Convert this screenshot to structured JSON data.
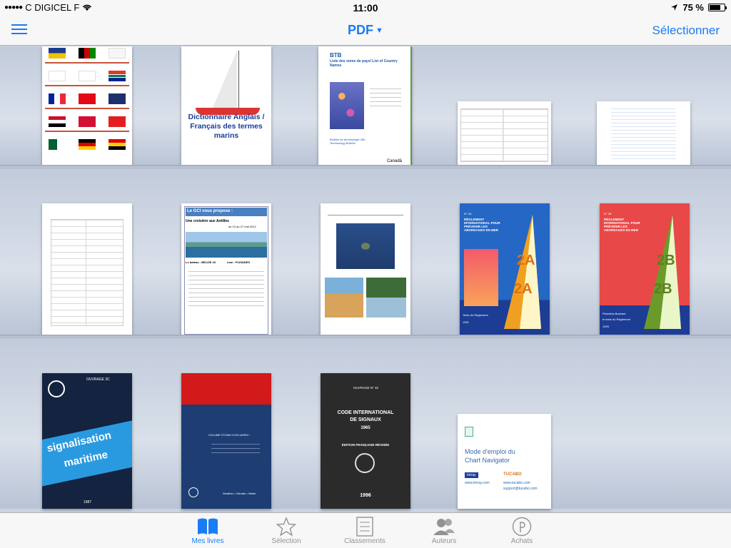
{
  "status": {
    "carrier": "C DIGICEL F",
    "time": "11:00",
    "battery": "75 %",
    "battery_fraction": 0.75
  },
  "nav": {
    "title": "PDF",
    "select_label": "Sélectionner"
  },
  "books": {
    "b2_title": "Dictionnaire Anglais / Français des termes marins",
    "b3_head": "Liste des noms de pays/ List of Country Names",
    "b3_brand": "BTB",
    "b3_sub": "Bulletin de terminologie 256 Terminology Bulletin",
    "b3_footer": "Canadä",
    "b7_head": "Le GCI vous propose :",
    "b7_sub": "Une croisière aux Antilles",
    "b7_dates": "du 13 au 27 mai 2012",
    "b7_boat1": "Le bateau : BELIZE 43",
    "b7_boat2": "nom : PLEIADES",
    "b9_head": "RÈGLEMENT INTERNATIONAL POUR PRÉVENIR LES ABORDAGES EN MER",
    "b9_foot": "Texte du Règlement",
    "b9_year": "1991",
    "b9_no": "N° 2A",
    "b10_head": "RÈGLEMENT INTERNATIONAL POUR PRÉVENIR LES ABORDAGES EN MER",
    "b10_foot1": "Planches illustrant",
    "b10_foot2": "le texte du Règlement",
    "b10_year": "1993",
    "b10_no": "N° 2B",
    "b11_ouvrage": "OUVRAGE 3C",
    "b11_word1": "signalisation",
    "b11_word2": "maritime",
    "b11_year": "1987",
    "b12_title": "VOLUME I/TOMO I/VOLUMEN I",
    "b12_foot": "Weather • Climate • Water",
    "b13_ouvrage": "OUVRAGE N° 32",
    "b13_title1": "CODE INTERNATIONAL",
    "b13_title2": "DE SIGNAUX",
    "b13_year1": "1965",
    "b13_edition": "ÉDITION FRANÇAISE RÉVISÉE",
    "b13_year2": "1996",
    "b14_title1": "Mode d'emploi du",
    "b14_title2": "Chart Navigator",
    "b14_brand1": "Imray",
    "b14_brand2": "TUCABO",
    "b14_link1": "www.imray.com",
    "b14_link2": "www.tucabo.com",
    "b14_link3": "support@tucabo.com"
  },
  "tabs": [
    {
      "label": "Mes livres",
      "icon": "book-icon"
    },
    {
      "label": "Sélection",
      "icon": "star-icon"
    },
    {
      "label": "Classements",
      "icon": "list-icon"
    },
    {
      "label": "Auteurs",
      "icon": "people-icon"
    },
    {
      "label": "Achats",
      "icon": "store-icon"
    }
  ],
  "colors": {
    "accent": "#1a7cf4"
  }
}
